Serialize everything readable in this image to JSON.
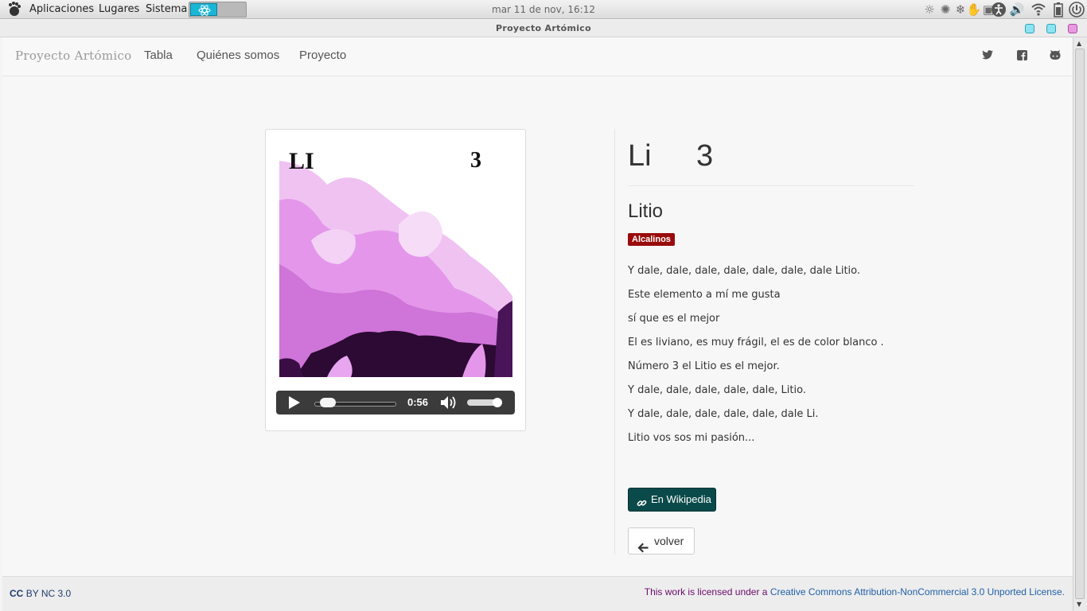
{
  "panel": {
    "menus": [
      "Aplicaciones",
      "Lugares",
      "Sistema"
    ],
    "clock": "mar 11 de nov, 16:12",
    "tray_icons": [
      "brightness-icon",
      "weather-icon",
      "network-handshake-icon",
      "screen-icon",
      "accessibility-icon",
      "volume-icon",
      "wifi-icon",
      "battery-icon",
      "power-icon"
    ]
  },
  "window": {
    "title": "Proyecto Artómico"
  },
  "navbar": {
    "brand": "Proyecto Artómico",
    "links": [
      "Tabla",
      "Quiénes somos",
      "Proyecto"
    ],
    "social_icons": [
      "twitter-icon",
      "facebook-icon",
      "github-icon"
    ]
  },
  "element": {
    "cover_symbol": "LI",
    "cover_number": "3",
    "symbol": "Li",
    "number": "3",
    "name": "Litio",
    "category": "Alcalinos",
    "category_color": "#9a0c0c",
    "lyrics": [
      "Y dale, dale, dale, dale, dale, dale, dale Litio.",
      "Este elemento a mí me gusta",
      "sí que es el mejor",
      "El es liviano, es muy frágil, el es de color blanco .",
      "Número 3 el Litio es el mejor.",
      "Y dale, dale, dale, dale, dale, Litio.",
      "Y dale, dale, dale, dale, dale, dale Li.",
      "Litio vos sos mi pasión..."
    ],
    "wiki_button": "En Wikipedia",
    "back_button": "volver"
  },
  "player": {
    "time": "0:56",
    "progress": 0.08,
    "volume": 0.85
  },
  "footer": {
    "cc_label": "CC",
    "cc_rest": "BY NC 3.0",
    "license_prefix": "This work is licensed under a ",
    "license_link": "Creative Commons Attribution-NonCommercial 3.0 Unported License."
  },
  "colors": {
    "wiki_button_bg": "#0b4a4a",
    "cover_pink": "#e9a6f0",
    "cover_dark": "#2b0b2b"
  }
}
